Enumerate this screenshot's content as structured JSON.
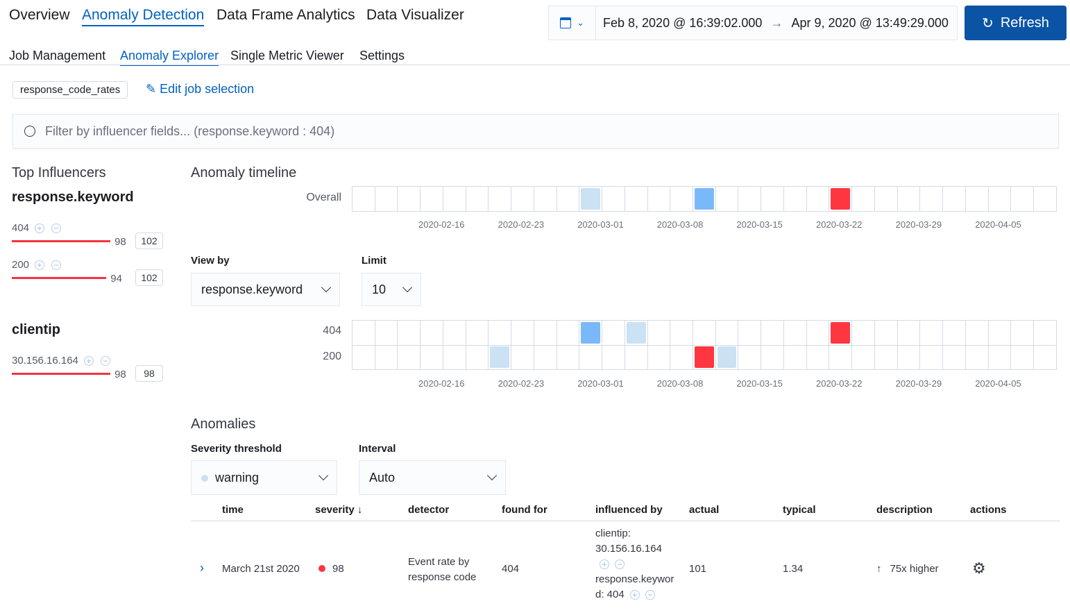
{
  "nav": {
    "tabs": [
      "Overview",
      "Anomaly Detection",
      "Data Frame Analytics",
      "Data Visualizer"
    ],
    "subtabs": [
      "Job Management",
      "Anomaly Explorer",
      "Single Metric Viewer",
      "Settings"
    ]
  },
  "date": {
    "start": "Feb 8, 2020 @ 16:39:02.000",
    "arrow": "→",
    "end": "Apr 9, 2020 @ 13:49:29.000",
    "refresh": "Refresh"
  },
  "job": {
    "badge": "response_code_rates",
    "edit": "Edit job selection"
  },
  "filter": {
    "placeholder": "Filter by influencer fields... (response.keyword : 404)"
  },
  "influencers": {
    "title": "Top Influencers",
    "groups": [
      {
        "field": "response.keyword",
        "items": [
          {
            "value": "404",
            "score": "98",
            "total": "102",
            "pct": 98
          },
          {
            "value": "200",
            "score": "94",
            "total": "102",
            "pct": 94
          }
        ]
      },
      {
        "field": "clientip",
        "items": [
          {
            "value": "30.156.16.164",
            "score": "98",
            "total": "98",
            "pct": 98
          }
        ]
      }
    ]
  },
  "timeline": {
    "title": "Anomaly timeline",
    "overall_label": "Overall",
    "cells": 31,
    "ticks": [
      "2020-02-16",
      "2020-02-23",
      "2020-03-01",
      "2020-03-08",
      "2020-03-15",
      "2020-03-22",
      "2020-03-29",
      "2020-04-05"
    ],
    "overall": {
      "10": "low",
      "15": "mid",
      "21": "high"
    },
    "rows": [
      {
        "label": "404",
        "cells": {
          "10": "mid",
          "12": "low",
          "21": "high"
        }
      },
      {
        "label": "200",
        "cells": {
          "6": "low",
          "15": "high",
          "16": "low"
        }
      }
    ]
  },
  "colors": {
    "low": "#cbe1f4",
    "mid": "#7ab9f9",
    "high": "#fe3640",
    "accent": "#0061c2"
  },
  "viewby": {
    "label": "View by",
    "value": "response.keyword"
  },
  "limit": {
    "label": "Limit",
    "value": "10"
  },
  "anomalies": {
    "title": "Anomalies",
    "severity_label": "Severity threshold",
    "severity_value": "warning",
    "interval_label": "Interval",
    "interval_value": "Auto",
    "columns": [
      "time",
      "severity",
      "detector",
      "found for",
      "influenced by",
      "actual",
      "typical",
      "description",
      "actions"
    ],
    "rows": [
      {
        "time": "March 21st 2020",
        "severity": "98",
        "detector": "Event rate by response code",
        "found_for": "404",
        "infl1": "clientip: 30.156.16.164",
        "infl2": "response.keywor d: 404",
        "actual": "101",
        "typical": "1.34",
        "description": "75x higher"
      }
    ]
  }
}
